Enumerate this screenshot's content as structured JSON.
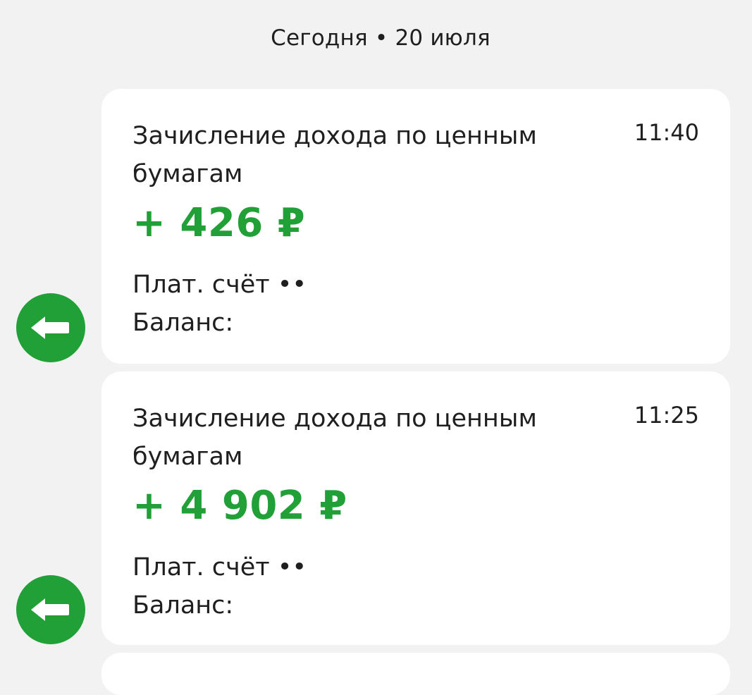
{
  "date_header": "Сегодня • 20 июля",
  "operations": [
    {
      "title": "Зачисление дохода по ценным бумагам",
      "time": "11:40",
      "amount": "+ 426 ₽",
      "account": "Плат. счёт ••",
      "balance": "Баланс:"
    },
    {
      "title": "Зачисление дохода по ценным бумагам",
      "time": "11:25",
      "amount": "+ 4 902 ₽",
      "account": "Плат. счёт ••",
      "balance": "Баланс:"
    }
  ],
  "icons": {
    "operation_icon": "incoming-arrow-left-icon"
  },
  "colors": {
    "accent_green": "#21a038",
    "background": "#f2f2f2",
    "card": "#ffffff",
    "text": "#1f1f1f"
  }
}
